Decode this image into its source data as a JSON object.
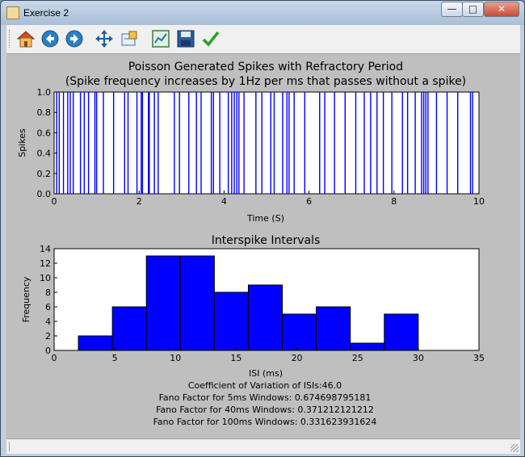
{
  "window": {
    "title": "Exercise 2"
  },
  "toolbar": {
    "icons": [
      "home-icon",
      "back-arrow-icon",
      "forward-arrow-icon",
      "pan-icon",
      "zoom-icon",
      "configure-subplots-icon",
      "save-icon",
      "edit-icon"
    ]
  },
  "colors": {
    "bars": "#0000ff",
    "spikes": "#0000ff",
    "figure_bg": "#bfbfbf"
  },
  "chart_data": [
    {
      "type": "line",
      "title": "Poisson Generated Spikes with Refractory Period",
      "subtitle": "(Spike frequency increases by 1Hz per ms that passes without a spike)",
      "xlabel": "Time (S)",
      "ylabel": "Spikes",
      "xlim": [
        0,
        10
      ],
      "ylim": [
        0,
        1
      ],
      "xticks": [
        "0",
        "2",
        "4",
        "6",
        "8",
        "10"
      ],
      "yticks": [
        "0.0",
        "0.2",
        "0.4",
        "0.6",
        "0.8",
        "1.0"
      ],
      "spike_times": [
        0.06,
        0.12,
        0.22,
        0.32,
        0.38,
        0.45,
        0.62,
        0.71,
        0.81,
        0.96,
        1.0,
        1.16,
        1.4,
        1.66,
        1.74,
        1.95,
        2.05,
        2.08,
        2.22,
        2.24,
        2.36,
        2.45,
        2.83,
        2.95,
        3.17,
        3.35,
        3.46,
        3.7,
        3.75,
        3.9,
        4.1,
        4.18,
        4.24,
        4.3,
        4.35,
        4.47,
        4.75,
        4.89,
        5.1,
        5.18,
        5.38,
        5.48,
        5.53,
        5.65,
        5.9,
        6.25,
        6.37,
        6.6,
        6.85,
        7.1,
        7.3,
        7.45,
        7.6,
        7.75,
        7.95,
        8.2,
        8.32,
        8.5,
        8.65,
        8.7,
        8.75,
        8.8,
        9.0,
        9.25,
        9.5,
        9.8,
        9.85
      ],
      "grid": false
    },
    {
      "type": "bar",
      "title": "Interspike Intervals",
      "xlabel": "ISI (ms)",
      "ylabel": "Frequency",
      "xlim": [
        0,
        35
      ],
      "ylim": [
        0,
        14
      ],
      "xticks": [
        "0",
        "5",
        "10",
        "15",
        "20",
        "25",
        "30",
        "35"
      ],
      "yticks": [
        "0",
        "2",
        "4",
        "6",
        "8",
        "10",
        "12",
        "14"
      ],
      "bin_edges": [
        2,
        4.8,
        7.6,
        10.4,
        13.2,
        16,
        18.8,
        21.6,
        24.4,
        27.2,
        30
      ],
      "values": [
        2,
        6,
        13,
        13,
        8,
        9,
        5,
        6,
        1,
        5
      ],
      "grid": false
    }
  ],
  "stats": {
    "cv": "Coefficient of Variation of ISIs:46.0",
    "fano5": "Fano Factor for 5ms Windows: 0.674698795181",
    "fano40": "Fano Factor for 40ms Windows: 0.371212121212",
    "fano100": "Fano Factor for 100ms Windows: 0.331623931624"
  }
}
